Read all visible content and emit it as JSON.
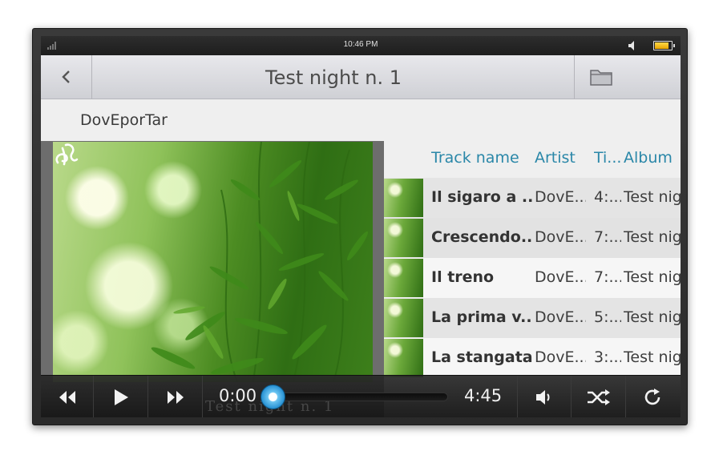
{
  "status_bar": {
    "time": "10:46 PM",
    "icons": [
      "signal-icon",
      "speaker-icon",
      "battery-icon"
    ]
  },
  "header": {
    "title": "Test night n. 1",
    "back_icon": "chevron-left-icon",
    "folder_icon": "folder-icon"
  },
  "artist_label": "DovEporTar",
  "columns": [
    "Track name",
    "Artist",
    "Ti...",
    "Album"
  ],
  "tracks": [
    {
      "name": "Il sigaro a ...",
      "artist": "DovE...",
      "time": "4:...",
      "album": "Test nig"
    },
    {
      "name": "Crescendo...",
      "artist": "DovE...",
      "time": "7:...",
      "album": "Test nig"
    },
    {
      "name": "Il treno",
      "artist": "DovE...",
      "time": "7:...",
      "album": "Test nig"
    },
    {
      "name": "La prima v...",
      "artist": "DovE...",
      "time": "5:...",
      "album": "Test nig"
    },
    {
      "name": "La stangata",
      "artist": "DovE...",
      "time": "3:...",
      "album": "Test nig"
    }
  ],
  "player": {
    "current_time": "0:00",
    "total_time": "4:45",
    "progress": 0.0,
    "watermark": "Test night n. 1",
    "icons": [
      "rewind-icon",
      "play-icon",
      "fast-forward-icon",
      "volume-icon",
      "shuffle-icon",
      "repeat-icon"
    ]
  },
  "colors": {
    "accent": "#2a87a8",
    "progress_knob": "#2a93d4",
    "header_bg": "#dcdde1",
    "player_bg": "#1e1e1e"
  }
}
